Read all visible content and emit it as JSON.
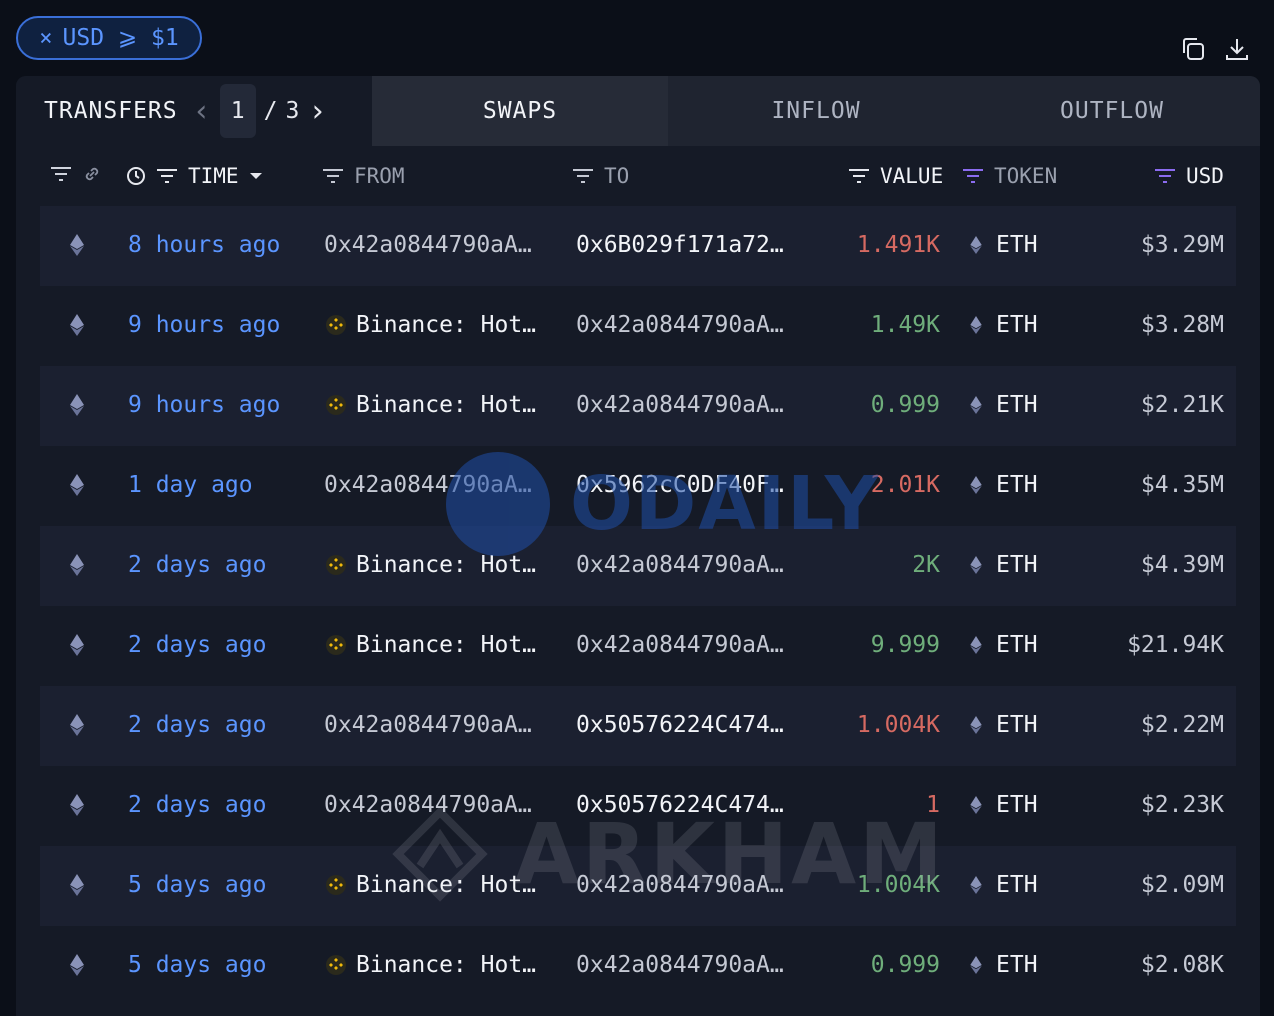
{
  "filter": {
    "close_glyph": "×",
    "label": "USD ⩾ $1"
  },
  "tabs": {
    "transfers_label": "TRANSFERS",
    "pager": {
      "current": "1",
      "separator": "/",
      "total": "3"
    },
    "swaps": "SWAPS",
    "inflow": "INFLOW",
    "outflow": "OUTFLOW"
  },
  "columns": {
    "time": "TIME",
    "from": "FROM",
    "to": "TO",
    "value": "VALUE",
    "token": "TOKEN",
    "usd": "USD"
  },
  "colors": {
    "accent": "#5b95ff",
    "outflow": "#d66a62",
    "inflow": "#6fae7b",
    "binance": "#f0b90b"
  },
  "rows": [
    {
      "time": "8 hours ago",
      "from": "0x42a0844790aA…",
      "from_entity": false,
      "to": "0x6B029f171a72…",
      "to_dim": false,
      "value": "1.491K",
      "dir": "out",
      "token": "ETH",
      "usd": "$3.29M"
    },
    {
      "time": "9 hours ago",
      "from": "Binance: Hot…",
      "from_entity": true,
      "to": "0x42a0844790aA…",
      "to_dim": true,
      "value": "1.49K",
      "dir": "in",
      "token": "ETH",
      "usd": "$3.28M"
    },
    {
      "time": "9 hours ago",
      "from": "Binance: Hot…",
      "from_entity": true,
      "to": "0x42a0844790aA…",
      "to_dim": true,
      "value": "0.999",
      "dir": "in",
      "token": "ETH",
      "usd": "$2.21K"
    },
    {
      "time": "1 day ago",
      "from": "0x42a0844790aA…",
      "from_entity": false,
      "to": "0x5962cC0DF40F…",
      "to_dim": false,
      "value": "2.01K",
      "dir": "out",
      "token": "ETH",
      "usd": "$4.35M"
    },
    {
      "time": "2 days ago",
      "from": "Binance: Hot…",
      "from_entity": true,
      "to": "0x42a0844790aA…",
      "to_dim": true,
      "value": "2K",
      "dir": "in",
      "token": "ETH",
      "usd": "$4.39M"
    },
    {
      "time": "2 days ago",
      "from": "Binance: Hot…",
      "from_entity": true,
      "to": "0x42a0844790aA…",
      "to_dim": true,
      "value": "9.999",
      "dir": "in",
      "token": "ETH",
      "usd": "$21.94K"
    },
    {
      "time": "2 days ago",
      "from": "0x42a0844790aA…",
      "from_entity": false,
      "to": "0x50576224C474…",
      "to_dim": false,
      "value": "1.004K",
      "dir": "out",
      "token": "ETH",
      "usd": "$2.22M"
    },
    {
      "time": "2 days ago",
      "from": "0x42a0844790aA…",
      "from_entity": false,
      "to": "0x50576224C474…",
      "to_dim": false,
      "value": "1",
      "dir": "out",
      "token": "ETH",
      "usd": "$2.23K"
    },
    {
      "time": "5 days ago",
      "from": "Binance: Hot…",
      "from_entity": true,
      "to": "0x42a0844790aA…",
      "to_dim": true,
      "value": "1.004K",
      "dir": "in",
      "token": "ETH",
      "usd": "$2.09M"
    },
    {
      "time": "5 days ago",
      "from": "Binance: Hot…",
      "from_entity": true,
      "to": "0x42a0844790aA…",
      "to_dim": true,
      "value": "0.999",
      "dir": "in",
      "token": "ETH",
      "usd": "$2.08K"
    }
  ],
  "watermarks": {
    "odaily": "ODAILY",
    "arkham": "ARKHAM"
  }
}
